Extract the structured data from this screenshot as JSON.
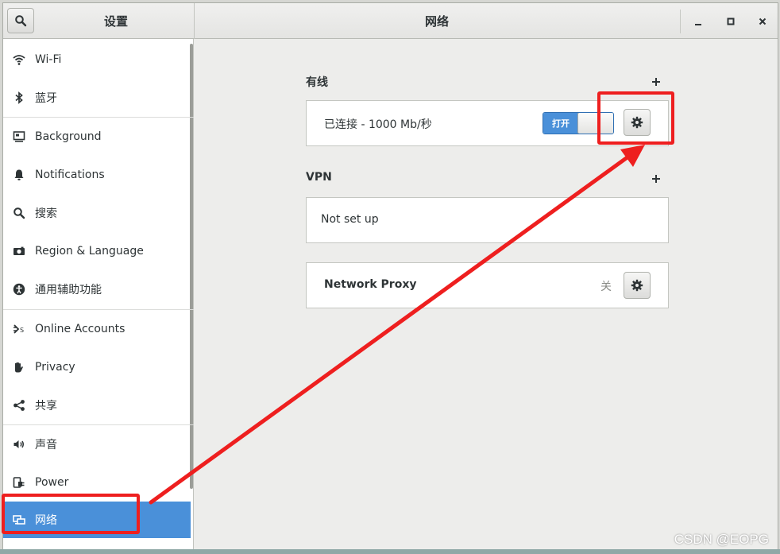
{
  "window": {
    "sidebar_title": "设置",
    "main_title": "网络"
  },
  "sidebar": {
    "items": [
      {
        "label": "Wi-Fi",
        "icon": "wifi-icon"
      },
      {
        "label": "蓝牙",
        "icon": "bluetooth-icon"
      },
      {
        "label": "Background",
        "icon": "background-icon"
      },
      {
        "label": "Notifications",
        "icon": "bell-icon"
      },
      {
        "label": "搜索",
        "icon": "search-icon"
      },
      {
        "label": "Region & Language",
        "icon": "camera-icon"
      },
      {
        "label": "通用辅助功能",
        "icon": "accessibility-icon"
      },
      {
        "label": "Online Accounts",
        "icon": "online-accounts-icon"
      },
      {
        "label": "Privacy",
        "icon": "hand-icon"
      },
      {
        "label": "共享",
        "icon": "share-icon"
      },
      {
        "label": "声音",
        "icon": "speaker-icon"
      },
      {
        "label": "Power",
        "icon": "power-plug-icon"
      },
      {
        "label": "网络",
        "icon": "network-icon",
        "selected": true
      }
    ]
  },
  "wired": {
    "title": "有线",
    "status": "已连接 - 1000 Mb/秒",
    "toggle_label": "打开",
    "toggle_state": "on"
  },
  "vpn": {
    "title": "VPN",
    "empty_text": "Not set up"
  },
  "proxy": {
    "title": "Network Proxy",
    "state_label": "关"
  },
  "watermark": "CSDN @EOPG",
  "colors": {
    "accent": "#4a90d9",
    "annotation": "#ee1f1f"
  }
}
